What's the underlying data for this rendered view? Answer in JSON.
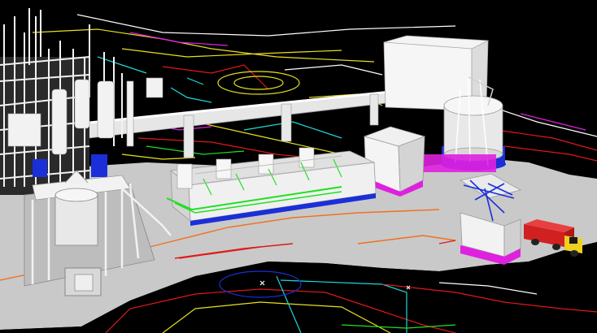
{
  "viewport": {
    "kind": "3D plant layout render (no visible text)",
    "background_color": "#000000",
    "ground_color": "#c9c9c9",
    "equipment_color": "#f2f2f2"
  },
  "accent_colors": {
    "pad_magenta": "#e020e0",
    "conveyor_blue": "#1a2fd8",
    "pipe_green": "#20e020",
    "cad_red": "#e01818",
    "cad_orange": "#f07020",
    "cad_yellow": "#e8e020",
    "cad_cyan": "#20d8d8",
    "truck_red": "#d02020",
    "truck_yellow": "#f0d020"
  },
  "objects": {
    "storage_building": "box-building",
    "silo": "cylindrical-silo",
    "pipe_rack": "overhead-pipe",
    "reactor_vessel": "reactor-vessel",
    "process_line": "process-line",
    "loading_shed": "loading-shed",
    "truck": "delivery-truck",
    "tower_structure": "process-tower-structure"
  }
}
